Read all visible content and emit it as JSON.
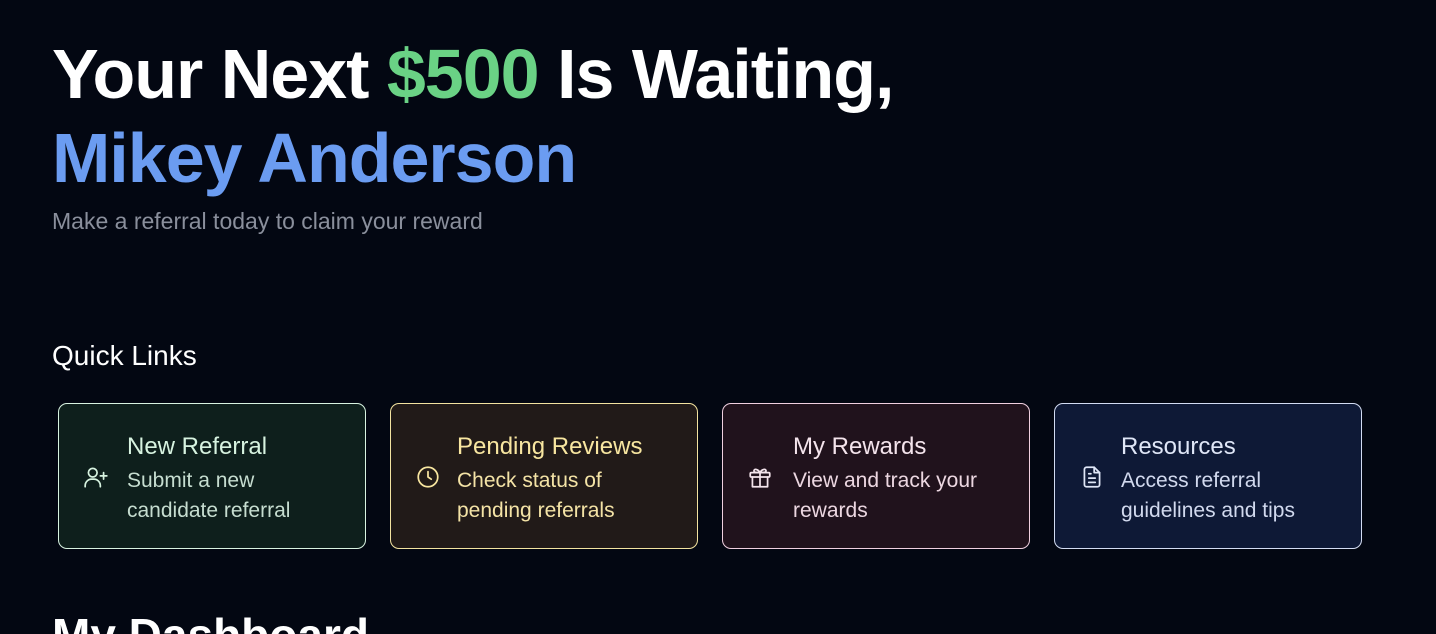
{
  "hero": {
    "line1_prefix": "Your Next ",
    "amount": "$500",
    "line1_suffix": " Is Waiting,",
    "name": "Mikey Anderson",
    "subtitle": "Make a referral today to claim your reward"
  },
  "quick_links": {
    "title": "Quick Links",
    "items": [
      {
        "title": "New Referral",
        "description": "Submit a new candidate referral",
        "icon": "user-plus-icon",
        "color": "#d7f3e0"
      },
      {
        "title": "Pending Reviews",
        "description": "Check status of pending referrals",
        "icon": "clock-icon",
        "color": "#f8e6a0"
      },
      {
        "title": "My Rewards",
        "description": "View and track your rewards",
        "icon": "gift-icon",
        "color": "#f4e4ec"
      },
      {
        "title": "Resources",
        "description": "Access referral guidelines and tips",
        "icon": "document-icon",
        "color": "#dfe6f7"
      }
    ]
  },
  "dashboard": {
    "title": "My Dashboard"
  },
  "colors": {
    "background": "#030712",
    "amount": "#6ad285",
    "name": "#6b9cf1"
  }
}
